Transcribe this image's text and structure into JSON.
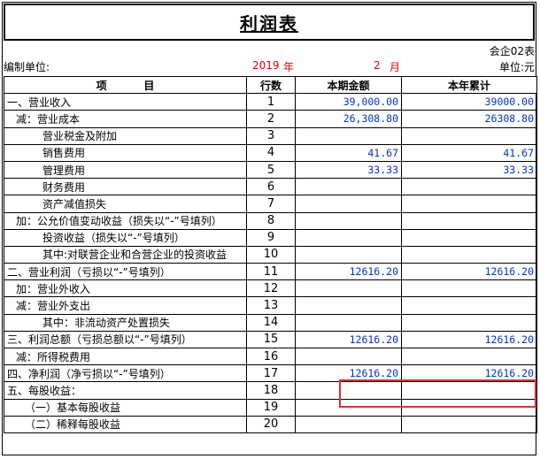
{
  "title": "利润表",
  "form_code": "会企02表",
  "meta": {
    "org_label": "编制单位:",
    "year": "2019",
    "year_unit": "年",
    "month": "2",
    "month_unit": "月",
    "unit_label": "单位:元"
  },
  "columns": {
    "item": "项          目",
    "line_no": "行数",
    "current": "本期金额",
    "ytd": "本年累计"
  },
  "rows": [
    {
      "item": "一、营业收入",
      "indent": 0,
      "line": "1",
      "current": "39,000.00",
      "ytd": "39000.00"
    },
    {
      "item": "减：营业成本",
      "indent": 1,
      "line": "2",
      "current": "26,308.80",
      "ytd": "26308.80"
    },
    {
      "item": "营业税金及附加",
      "indent": 3,
      "line": "3",
      "current": "",
      "ytd": ""
    },
    {
      "item": "销售费用",
      "indent": 3,
      "line": "4",
      "current": "41.67",
      "ytd": "41.67"
    },
    {
      "item": "管理费用",
      "indent": 3,
      "line": "5",
      "current": "33.33",
      "ytd": "33.33"
    },
    {
      "item": "财务费用",
      "indent": 3,
      "line": "6",
      "current": "",
      "ytd": ""
    },
    {
      "item": "资产减值损失",
      "indent": 3,
      "line": "7",
      "current": "",
      "ytd": ""
    },
    {
      "item": "加：公允价值变动收益（损失以“-”号填列）",
      "indent": 1,
      "line": "8",
      "current": "",
      "ytd": ""
    },
    {
      "item": "投资收益（损失以“-”号填列）",
      "indent": 3,
      "line": "9",
      "current": "",
      "ytd": ""
    },
    {
      "item": "其中:对联营企业和合营企业的投资收益",
      "indent": 3,
      "line": "10",
      "current": "",
      "ytd": ""
    },
    {
      "item": "二、营业利润（亏损以“-”号填列）",
      "indent": 0,
      "line": "11",
      "current": "12616.20",
      "ytd": "12616.20"
    },
    {
      "item": "加：营业外收入",
      "indent": 1,
      "line": "12",
      "current": "",
      "ytd": ""
    },
    {
      "item": "减：营业外支出",
      "indent": 1,
      "line": "13",
      "current": "",
      "ytd": ""
    },
    {
      "item": "其中：非流动资产处置损失",
      "indent": 3,
      "line": "14",
      "current": "",
      "ytd": ""
    },
    {
      "item": "三、利润总额（亏损总额以“-”号填列）",
      "indent": 0,
      "line": "15",
      "current": "12616.20",
      "ytd": "12616.20"
    },
    {
      "item": "减：所得税费用",
      "indent": 1,
      "line": "16",
      "current": "",
      "ytd": ""
    },
    {
      "item": "四、净利润（净亏损以“-”号填列）",
      "indent": 0,
      "line": "17",
      "current": "12616.20",
      "ytd": "12616.20"
    },
    {
      "item": "五、每股收益：",
      "indent": 0,
      "line": "18",
      "current": "",
      "ytd": ""
    },
    {
      "item": "（一）基本每股收益",
      "indent": 2,
      "line": "19",
      "current": "",
      "ytd": ""
    },
    {
      "item": "（二）稀释每股收益",
      "indent": 2,
      "line": "20",
      "current": "",
      "ytd": ""
    }
  ],
  "colors": {
    "value_blue": "#0033cc",
    "date_red": "#e60000",
    "highlight_red": "#e03030"
  }
}
